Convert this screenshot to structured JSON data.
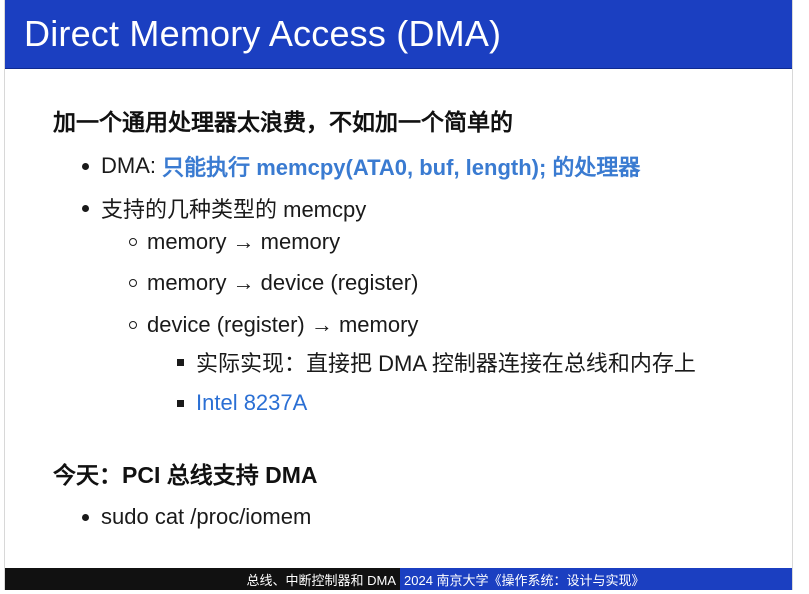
{
  "title": "Direct Memory Access (DMA)",
  "section1": {
    "heading": "加一个通用处理器太浪费，不如加一个简单的",
    "items": [
      {
        "prefix": "DMA: ",
        "accent": "只能执行 memcpy(ATA0, buf, length); 的处理器"
      },
      {
        "text": "支持的几种类型的 memcpy"
      }
    ],
    "subitems": [
      "memory → memory",
      "memory → device (register)",
      "device (register) → memory"
    ],
    "subsubitems": [
      "实际实现：直接把 DMA 控制器连接在总线和内存上",
      "Intel 8237A"
    ]
  },
  "section2": {
    "heading": "今天：PCI 总线支持 DMA",
    "items": [
      "sudo cat /proc/iomem"
    ]
  },
  "footer": {
    "left": "总线、中断控制器和 DMA",
    "right": "2024 南京大学《操作系统：设计与实现》"
  },
  "colors": {
    "title_bar": "#1b3fc1",
    "accent": "#3a7bd1",
    "link": "#2a6fd4",
    "footer_left": "#111111",
    "footer_right": "#1b3fc1"
  }
}
